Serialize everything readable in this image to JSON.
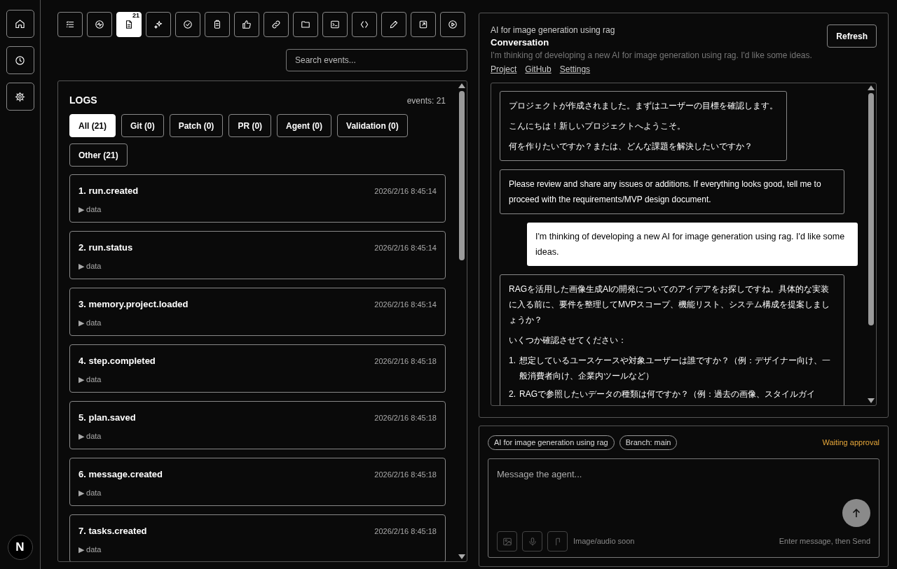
{
  "sidebar": {
    "items": [
      {
        "kind": "home",
        "selected": false
      },
      {
        "kind": "history",
        "selected": false
      },
      {
        "kind": "settings",
        "selected": false
      }
    ],
    "logo": "N"
  },
  "toolbar": [
    {
      "kind": "list",
      "selected": false
    },
    {
      "kind": "activity",
      "selected": false
    },
    {
      "kind": "file",
      "selected": true,
      "badge": "21"
    },
    {
      "kind": "sparkles",
      "selected": false
    },
    {
      "kind": "check",
      "selected": false
    },
    {
      "kind": "clipboard",
      "selected": false
    },
    {
      "kind": "thumb",
      "selected": false
    },
    {
      "kind": "link",
      "selected": false
    },
    {
      "kind": "folder",
      "selected": false
    },
    {
      "kind": "terminal",
      "selected": false
    },
    {
      "kind": "code",
      "selected": false
    },
    {
      "kind": "pencil",
      "selected": false
    },
    {
      "kind": "external",
      "selected": false
    },
    {
      "kind": "play",
      "selected": false
    }
  ],
  "search": {
    "placeholder": "Search events..."
  },
  "logs": {
    "title": "LOGS",
    "count": "events: 21",
    "filters": [
      {
        "label": "All (21)",
        "selected": true
      },
      {
        "label": "Git (0)",
        "selected": false
      },
      {
        "label": "Patch (0)",
        "selected": false
      },
      {
        "label": "PR (0)",
        "selected": false
      },
      {
        "label": "Agent (0)",
        "selected": false
      },
      {
        "label": "Validation (0)",
        "selected": false
      },
      {
        "label": "Other (21)",
        "selected": false
      }
    ],
    "events": [
      {
        "title": "1. run.created",
        "time": "2026/2/16 8:45:14",
        "summary": "▶ data"
      },
      {
        "title": "2. run.status",
        "time": "2026/2/16 8:45:14",
        "summary": "▶ data"
      },
      {
        "title": "3. memory.project.loaded",
        "time": "2026/2/16 8:45:14",
        "summary": "▶ data"
      },
      {
        "title": "4. step.completed",
        "time": "2026/2/16 8:45:18",
        "summary": "▶ data"
      },
      {
        "title": "5. plan.saved",
        "time": "2026/2/16 8:45:18",
        "summary": "▶ data"
      },
      {
        "title": "6. message.created",
        "time": "2026/2/16 8:45:18",
        "summary": "▶ data"
      },
      {
        "title": "7. tasks.created",
        "time": "2026/2/16 8:45:18",
        "summary": "▶ data"
      }
    ]
  },
  "conversation": {
    "project": "AI for image generation using rag",
    "title": "Conversation",
    "description": "I'm thinking of developing a new AI for image generation using rag. I'd like some ideas.",
    "links": [
      "Project",
      "GitHub",
      "Settings"
    ],
    "refresh": "Refresh",
    "messages": [
      {
        "kind": "assistant",
        "blocks": [
          {
            "kind": "p",
            "text": "プロジェクトが作成されました。まずはユーザーの目標を確認します。"
          },
          {
            "kind": "p",
            "text": "こんにちは！新しいプロジェクトへようこそ。"
          },
          {
            "kind": "p",
            "text": "何を作りたいですか？または、どんな課題を解決したいですか？"
          }
        ]
      },
      {
        "kind": "assistant",
        "blocks": [
          {
            "kind": "p",
            "text": "Please review and share any issues or additions. If everything looks good, tell me to proceed with the requirements/MVP design document."
          }
        ]
      },
      {
        "kind": "user",
        "blocks": [
          {
            "kind": "p",
            "text": "I'm thinking of developing a new AI for image generation using rag. I'd like some ideas."
          }
        ]
      },
      {
        "kind": "assistant",
        "blocks": [
          {
            "kind": "p",
            "text": "RAGを活用した画像生成AIの開発についてのアイデアをお探しですね。具体的な実装に入る前に、要件を整理してMVPスコープ、機能リスト、システム構成を提案しましょうか？"
          },
          {
            "kind": "p",
            "text": "いくつか確認させてください："
          },
          {
            "kind": "ol",
            "items": [
              {
                "number": "1.",
                "text": "想定しているユースケースや対象ユーザーは誰ですか？（例：デザイナー向け、一般消費者向け、企業内ツールなど）"
              },
              {
                "number": "2.",
                "text": "RAGで参照したいデータの種類は何ですか？（例：過去の画像、スタイルガイ"
              }
            ]
          }
        ]
      }
    ]
  },
  "composer": {
    "chips": [
      "AI for image generation using rag",
      "Branch: main"
    ],
    "status": "Waiting approval",
    "placeholder": "Message the agent...",
    "attachments": [
      {
        "kind": "image",
        "disabled": true
      },
      {
        "kind": "mic",
        "disabled": true
      },
      {
        "kind": "clip",
        "disabled": true
      }
    ],
    "attach_hint": "Image/audio soon",
    "send_hint": "Enter message, then Send"
  }
}
